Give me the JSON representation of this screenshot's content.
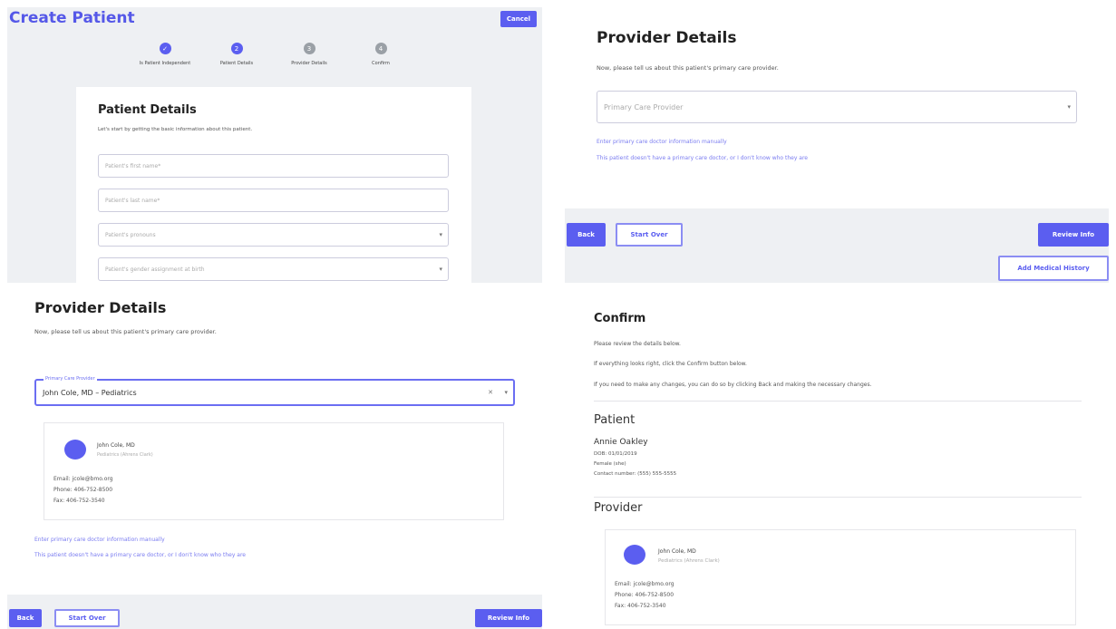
{
  "q1": {
    "title": "Create Patient",
    "cancel_label": "Cancel",
    "steps": [
      {
        "label": "Is Patient Independent",
        "state": "complete"
      },
      {
        "label": "Patient Details",
        "state": "current"
      },
      {
        "label": "Provider Details",
        "state": "pending"
      },
      {
        "label": "Confirm",
        "state": "pending"
      }
    ],
    "card_title": "Patient Details",
    "card_intro": "Let's start by getting the basic information about this patient.",
    "fields": [
      {
        "placeholder": "Patient's first name*"
      },
      {
        "placeholder": "Patient's last name*"
      },
      {
        "placeholder": "Patient's pronouns"
      },
      {
        "placeholder": "Patient's gender assignment at birth"
      }
    ]
  },
  "q2": {
    "title": "Provider Details",
    "intro": "Now, please tell us about this patient's primary care provider.",
    "select_placeholder": "Primary Care Provider",
    "link_manual": "Enter primary care doctor information manually",
    "link_none": "This patient doesn't have a primary care doctor, or I don't know who they are",
    "back_label": "Back",
    "start_over_label": "Start Over",
    "review_label": "Review Info",
    "add_history_label": "Add Medical History"
  },
  "q3": {
    "title": "Provider Details",
    "intro": "Now, please tell us about this patient's primary care provider.",
    "select_label": "Primary Care Provider",
    "select_value": "John Cole, MD – Pediatrics",
    "clear_glyph": "✕",
    "provider_name": "John Cole, MD",
    "provider_sub": "Pediatrics (Ahrens Clark)",
    "email": "Email: jcole@bmo.org",
    "phone": "Phone: 406-752-8500",
    "fax": "Fax: 406-752-3540",
    "link_manual": "Enter primary care doctor information manually",
    "link_none": "This patient doesn't have a primary care doctor, or I don't know who they are",
    "back_label": "Back",
    "start_over_label": "Start Over",
    "review_label": "Review Info"
  },
  "q4": {
    "title": "Confirm",
    "line1": "Please review the details below.",
    "line2": "If everything looks right, click the Confirm button below.",
    "line3": "If you need to make any changes, you can do so by clicking Back and making the necessary changes.",
    "patient_heading": "Patient",
    "patient_name": "Annie Oakley",
    "dob": "DOB: 01/01/2019",
    "gender": "Female (she)",
    "contact": "Contact number: (555) 555-5555",
    "provider_heading": "Provider",
    "provider_name": "John Cole, MD",
    "provider_sub": "Pediatrics (Ahrens Clark)",
    "email": "Email: jcole@bmo.org",
    "phone": "Phone: 406-752-8500",
    "fax": "Fax: 406-752-3540"
  },
  "colors": {
    "accent": "#5b5ef0",
    "step_done": "#5b5ef0",
    "step_pending": "#9aa0a6"
  }
}
